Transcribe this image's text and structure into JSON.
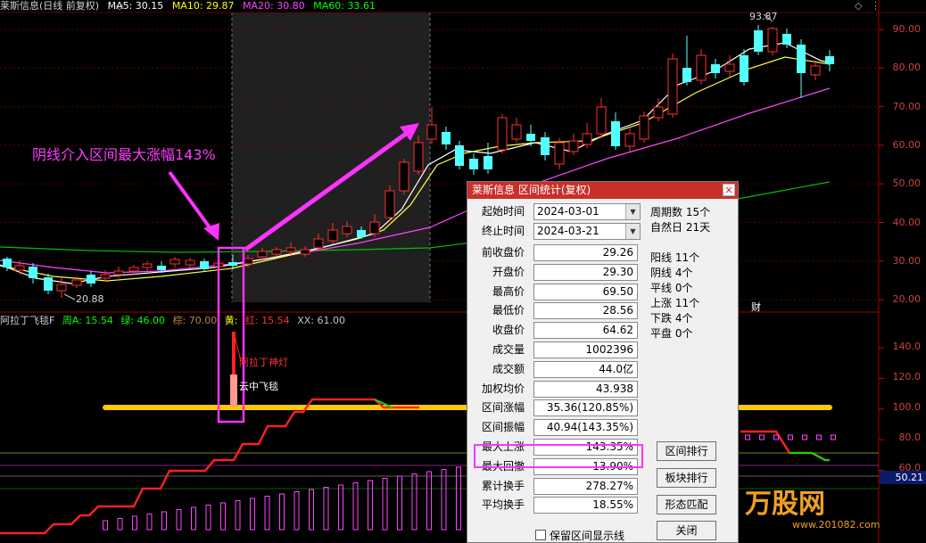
{
  "header": {
    "title": "莱斯信息(日线 前复权)",
    "ma5": "MA5: 30.15",
    "ma10": "MA10: 29.87",
    "ma20": "MA20: 30.80",
    "ma60": "MA60: 33.61",
    "colors": {
      "title": "#d0d0d0",
      "ma5": "#ffffff",
      "ma10": "#ffff00",
      "ma20": "#ff44ff",
      "ma60": "#00ff00"
    }
  },
  "price_axis": [
    "90.00",
    "80.00",
    "70.00",
    "60.00",
    "50.00",
    "40.00",
    "30.00",
    "20.00"
  ],
  "indicator_axis": [
    "140.0",
    "120.0",
    "100.0",
    "80.0",
    "60.0"
  ],
  "indicator_axis_highlight": "50.21",
  "price_marks": {
    "high": "93.87",
    "low": "20.88"
  },
  "annotations": {
    "main_text": "阴线介入区间最大涨幅143%",
    "lamp_text": "阿拉丁神灯",
    "cloud_text": "云中飞毯",
    "cai_text": "财"
  },
  "indicator_header": {
    "name": "阿拉丁飞毯F",
    "zhou": "周A: 15.54",
    "lv": "绿: 46.00",
    "zong": "棕: 70.00",
    "huang": "黄:",
    "hong": "红: 15.54",
    "xx": "XX: 61.00"
  },
  "dialog": {
    "title": "莱斯信息 区间统计(复权)",
    "close_label": "×",
    "start_label": "起始时间",
    "start_value": "2024-03-01",
    "end_label": "终止时间",
    "end_value": "2024-03-21",
    "fields": [
      {
        "label": "前收盘价",
        "value": "29.26"
      },
      {
        "label": "开盘价",
        "value": "29.30"
      },
      {
        "label": "最高价",
        "value": "69.50"
      },
      {
        "label": "最低价",
        "value": "28.56"
      },
      {
        "label": "收盘价",
        "value": "64.62"
      },
      {
        "label": "成交量",
        "value": "1002396"
      },
      {
        "label": "成交额",
        "value": "44.0亿"
      },
      {
        "label": "加权均价",
        "value": "43.938"
      },
      {
        "label": "区间涨幅",
        "value": "35.36(120.85%)"
      },
      {
        "label": "区间振幅",
        "value": "40.94(143.35%)"
      },
      {
        "label": "最大上涨",
        "value": "143.35%"
      },
      {
        "label": "最大回撤",
        "value": "-13.90%"
      },
      {
        "label": "累计换手",
        "value": "278.27%"
      },
      {
        "label": "平均换手",
        "value": "18.55%"
      }
    ],
    "stats": [
      "周期数 15个",
      "自然日 21天",
      "",
      "阳线 11个",
      "阴线 4个",
      "平线 0个",
      "上涨 11个",
      "下跌 4个",
      "平盘 0个"
    ],
    "buttons": [
      "区间排行",
      "板块排行",
      "形态匹配",
      "关闭"
    ],
    "checkbox_label": "保留区间显示线"
  },
  "watermark": {
    "brand": "万股网",
    "url": "www.201082.com"
  }
}
